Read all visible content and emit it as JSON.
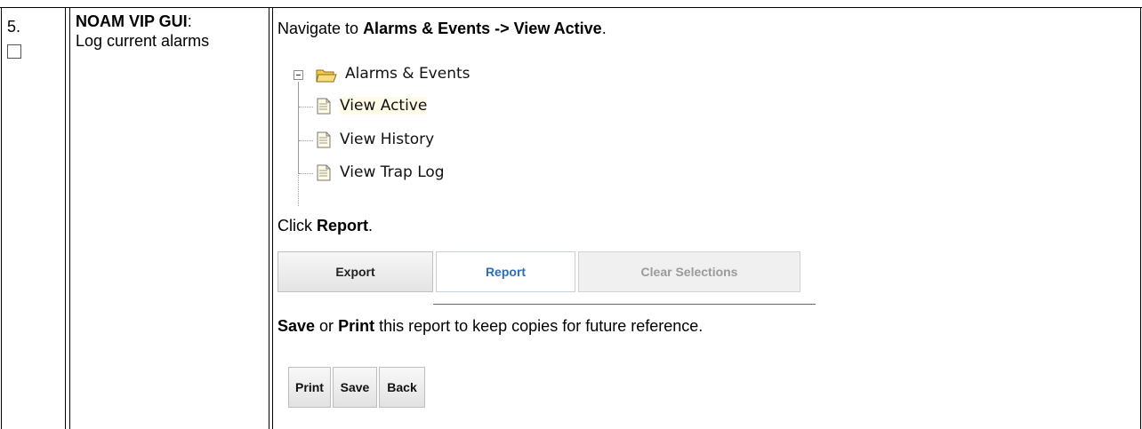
{
  "step": {
    "number": "5.",
    "title_bold": "NOAM VIP GUI",
    "title_colon": ":",
    "title_desc": "Log current alarms"
  },
  "instruction1": {
    "prefix": "Navigate to ",
    "bold": "Alarms & Events -> View Active",
    "suffix": "."
  },
  "tree": {
    "root": "Alarms & Events",
    "items": [
      "View Active",
      "View History",
      "View Trap Log"
    ]
  },
  "instruction2": {
    "prefix": "Click ",
    "bold": "Report",
    "suffix": "."
  },
  "buttons1": {
    "export": "Export",
    "report": "Report",
    "clear": "Clear Selections"
  },
  "instruction3": {
    "bold1": "Save",
    "mid": " or ",
    "bold2": "Print",
    "suffix": " this report to keep copies for future reference."
  },
  "buttons2": {
    "print": "Print",
    "save": "Save",
    "back": "Back"
  }
}
